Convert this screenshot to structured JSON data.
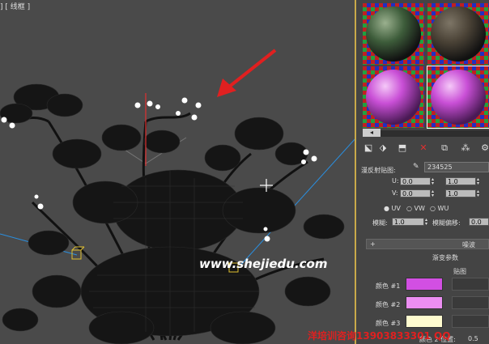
{
  "viewport": {
    "label": "] [ 线框 ]",
    "watermark_url": "www.shejiedu.com",
    "watermark_phone": "洋培训咨询13903833301 QQ"
  },
  "material_editor": {
    "spheres": [
      {
        "name": "dark-green-leaf",
        "color": "#3d5c3a",
        "highlight": "#9ab08e"
      },
      {
        "name": "dark-bark",
        "color": "#4a4236",
        "highlight": "#7d7566"
      },
      {
        "name": "pink-flower",
        "color": "#c94fd6",
        "highlight": "#f5c8f8"
      },
      {
        "name": "pink-flower-selected",
        "color": "#b44fd0",
        "highlight": "#f1c4f6",
        "selected": true
      }
    ],
    "scroll_left": "◂",
    "diffuse_label": "漫反射贴图:",
    "diffuse_map": "234525",
    "u_label": "U:",
    "u_offset": "0.0",
    "u_tiling": "1.0",
    "v_label": "V:",
    "v_offset": "0.0",
    "v_tiling": "1.0",
    "uv_options": [
      "UV",
      "VW",
      "WU"
    ],
    "uv_selected": "UV",
    "blur_label": "模糊:",
    "blur_value": "1.0",
    "blur_offset_label": "模糊偏移:",
    "blur_offset_value": "0.0",
    "noise_plus": "+",
    "noise_label": "噪波",
    "gradient_params_label": "渐变参数",
    "maps_label": "贴图",
    "color1_label": "颜色 #1",
    "color1": "#d24fe3",
    "color2_label": "颜色 #2",
    "color2": "#ec8ef2",
    "color3_label": "颜色 #3",
    "color3": "#fffccf",
    "color2_pos_label": "颜色 2 位置:",
    "color2_pos_value": "0.5"
  },
  "colors": {
    "selection_frame": "#c9a94a",
    "annotation_arrow": "#e02020",
    "light_line": "#2a8fe0"
  }
}
